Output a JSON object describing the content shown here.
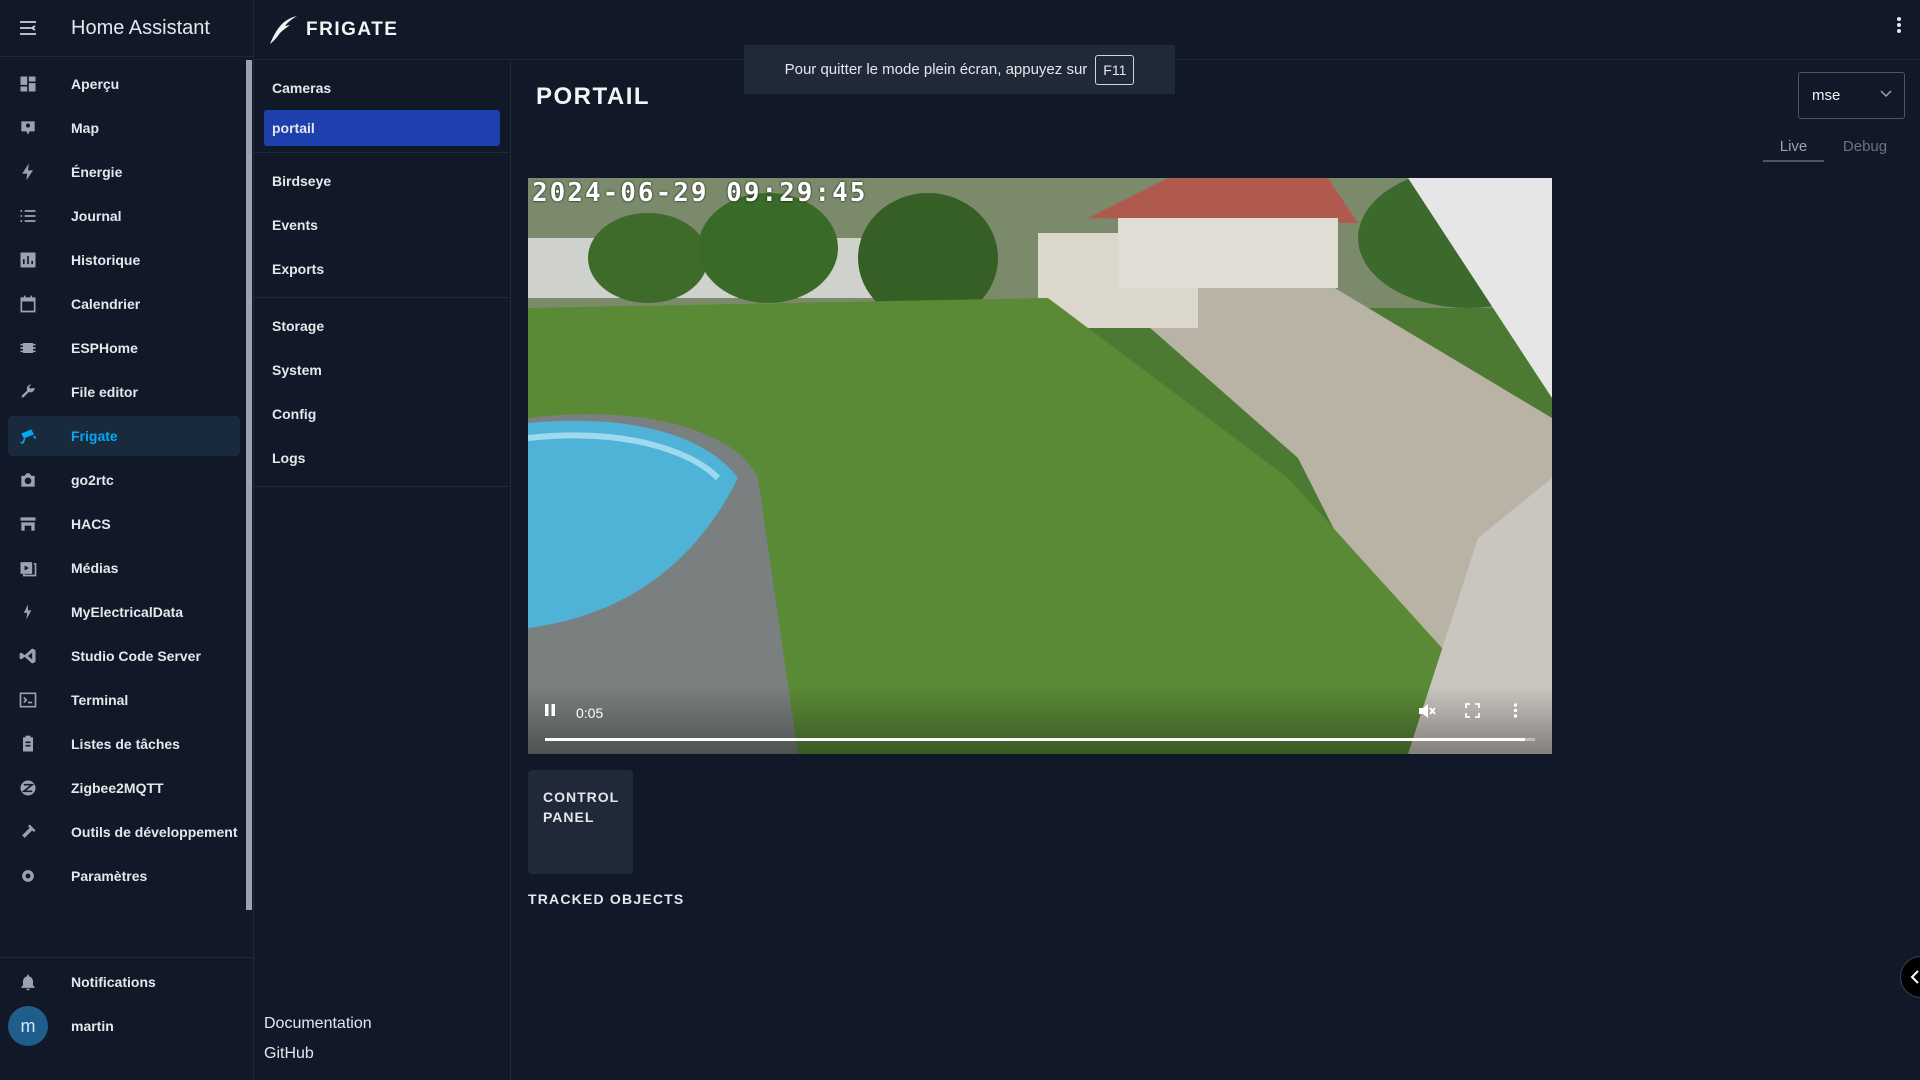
{
  "ha": {
    "title": "Home Assistant",
    "nav": [
      {
        "label": "Aperçu",
        "icon": "dashboard-icon"
      },
      {
        "label": "Map",
        "icon": "map-icon"
      },
      {
        "label": "Énergie",
        "icon": "lightning-icon"
      },
      {
        "label": "Journal",
        "icon": "list-icon"
      },
      {
        "label": "Historique",
        "icon": "chart-icon"
      },
      {
        "label": "Calendrier",
        "icon": "calendar-icon"
      },
      {
        "label": "ESPHome",
        "icon": "chip-icon"
      },
      {
        "label": "File editor",
        "icon": "wrench-icon"
      },
      {
        "label": "Frigate",
        "icon": "cctv-icon",
        "active": true
      },
      {
        "label": "go2rtc",
        "icon": "camera-icon"
      },
      {
        "label": "HACS",
        "icon": "store-icon"
      },
      {
        "label": "Médias",
        "icon": "media-icon"
      },
      {
        "label": "MyElectricalData",
        "icon": "flash-icon"
      },
      {
        "label": "Studio Code Server",
        "icon": "vscode-icon"
      },
      {
        "label": "Terminal",
        "icon": "terminal-icon"
      },
      {
        "label": "Listes de tâches",
        "icon": "clipboard-icon"
      },
      {
        "label": "Zigbee2MQTT",
        "icon": "zigbee-icon"
      },
      {
        "label": "Outils de développement",
        "icon": "hammer-icon"
      },
      {
        "label": "Paramètres",
        "icon": "gear-icon"
      }
    ],
    "notifications_label": "Notifications",
    "user_name": "martin",
    "user_initial": "m"
  },
  "frigate": {
    "brand": "FRIGATE",
    "nav_groups": [
      [
        "Cameras",
        "portail"
      ],
      [
        "Birdseye",
        "Events",
        "Exports"
      ],
      [
        "Storage",
        "System",
        "Config",
        "Logs"
      ]
    ],
    "active_item": "portail",
    "footer_links": [
      "Documentation",
      "GitHub"
    ]
  },
  "toast": {
    "text": "Pour quitter le mode plein écran, appuyez sur",
    "key": "F11"
  },
  "main": {
    "title": "PORTAIL",
    "source_value": "mse",
    "tabs": [
      {
        "label": "Live",
        "active": true
      },
      {
        "label": "Debug",
        "active": false
      }
    ],
    "video": {
      "timestamp": "2024-06-29 09:29:45",
      "time": "0:05",
      "progress": 0.99
    },
    "control_panel_label": "CONTROL\nPANEL",
    "tracked_title": "TRACKED OBJECTS"
  }
}
